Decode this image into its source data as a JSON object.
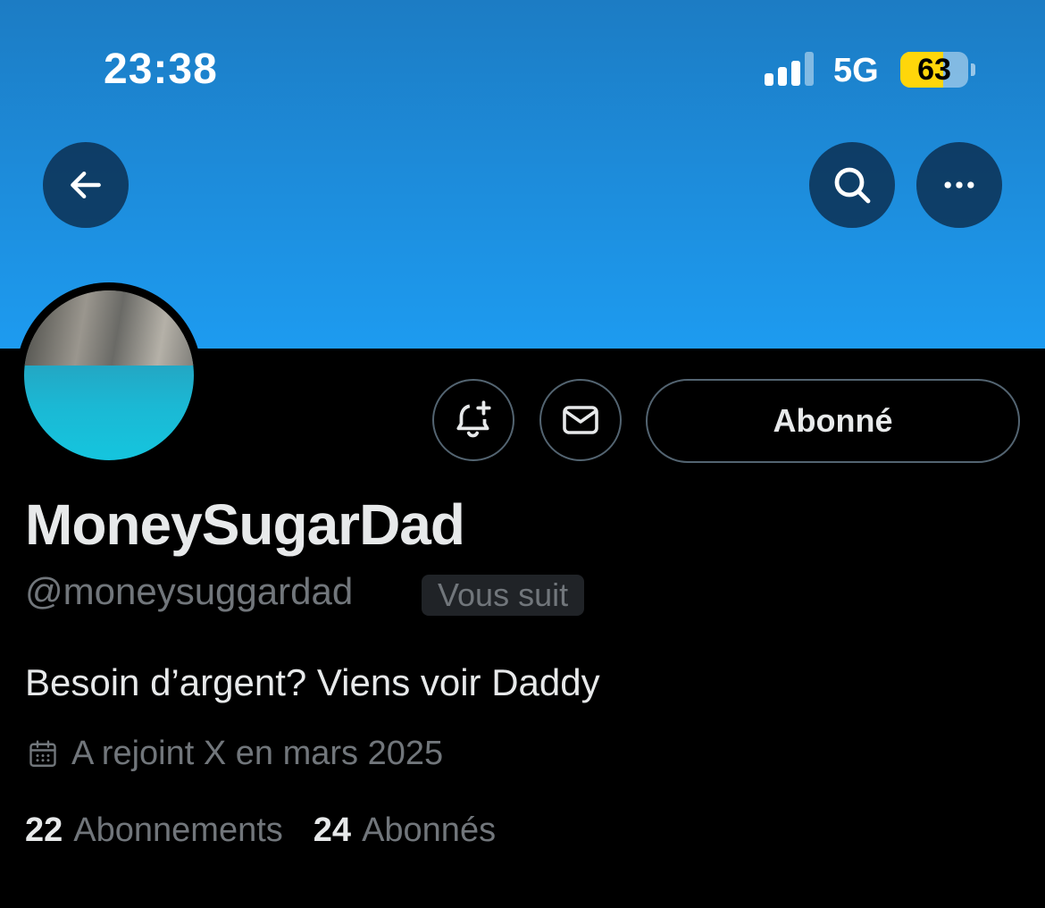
{
  "status_bar": {
    "time": "23:38",
    "network": "5G",
    "battery_level": "63",
    "battery_percent": 63,
    "battery_color": "#ffd60a",
    "signal_bars_active": 3,
    "signal_bars_total": 4
  },
  "header": {
    "back_icon": "arrow-left-icon",
    "search_icon": "search-icon",
    "more_icon": "more-horizontal-icon",
    "banner_color": "#1d9bf0"
  },
  "profile": {
    "display_name": "MoneySugarDad",
    "handle": "@moneysuggardad",
    "follows_you_badge": "Vous suit",
    "bio": "Besoin d’argent? Viens voir Daddy",
    "joined": "A rejoint X en mars 2025",
    "following_count": "22",
    "following_label": "Abonnements",
    "followers_count": "24",
    "followers_label": "Abonnés"
  },
  "actions": {
    "notify_icon": "bell-plus-icon",
    "message_icon": "envelope-icon",
    "follow_label": "Abonné"
  }
}
